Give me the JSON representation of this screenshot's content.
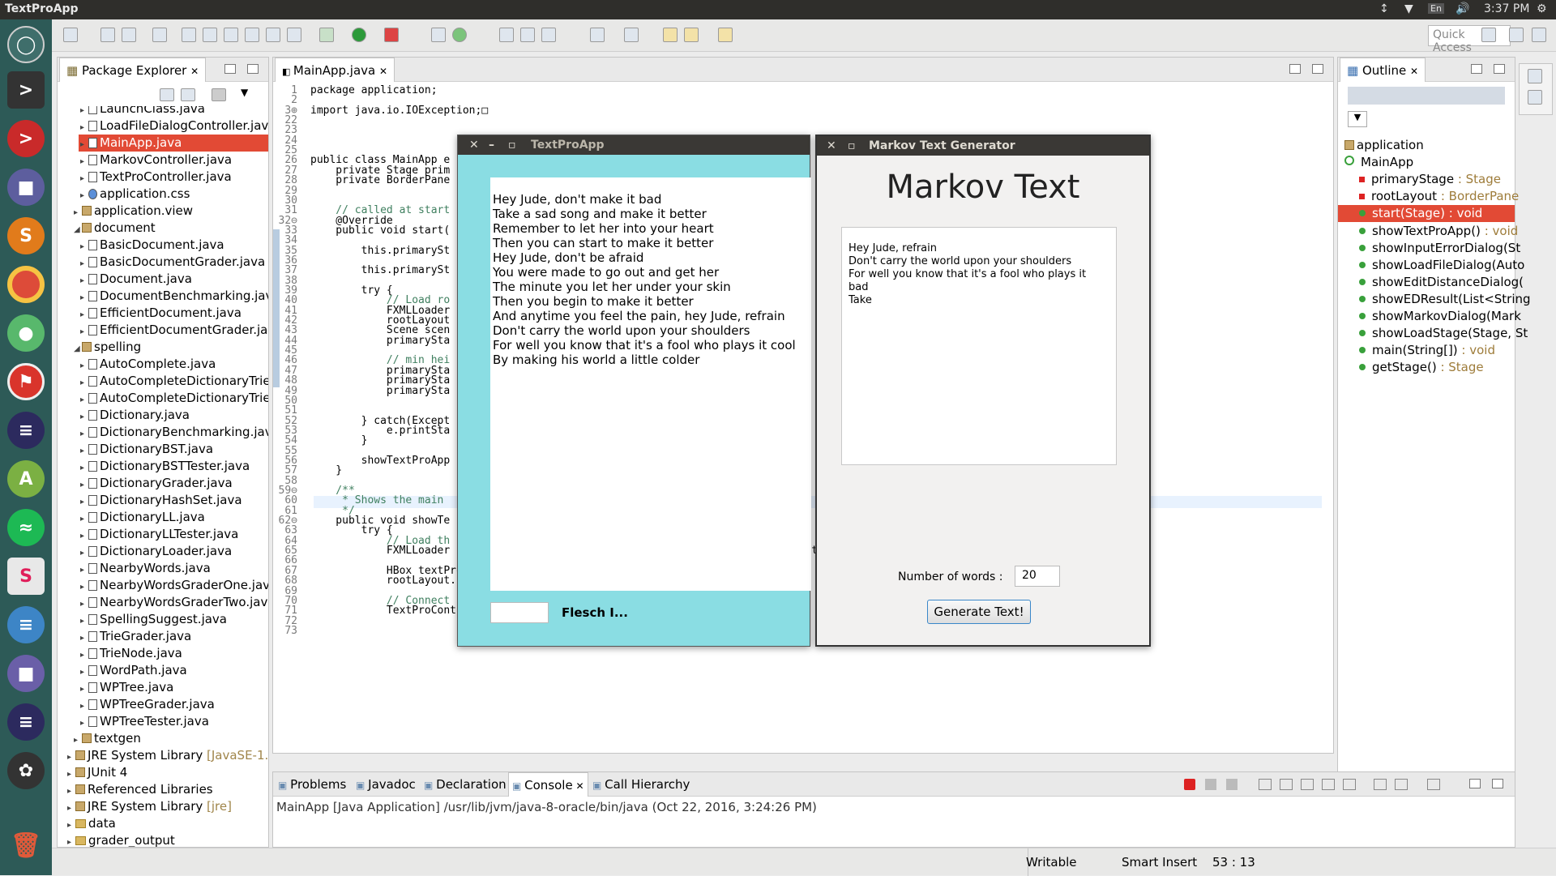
{
  "topbar": {
    "app_title": "TextProApp",
    "lang": "En",
    "time": "3:37 PM"
  },
  "launcher": {
    "icons": [
      "ubuntu-icon",
      "terminal-icon",
      "terminal-red-icon",
      "files-icon",
      "sublime-icon",
      "chrome-icon",
      "toggle-icon",
      "bookmark-icon",
      "eclipse-icon",
      "android-icon",
      "spotify-icon",
      "slack-icon",
      "document-icon",
      "folder-icon",
      "eclipse2-icon",
      "settings-icon",
      "trash-icon"
    ]
  },
  "toolbar": {
    "quick_access": "Quick Access"
  },
  "package_explorer": {
    "title": "Package Explorer",
    "items": [
      {
        "label": "LaunchClass.java",
        "indent": 3,
        "kind": "file"
      },
      {
        "label": "LoadFileDialogController.java",
        "indent": 3,
        "kind": "file"
      },
      {
        "label": "MainApp.java",
        "indent": 3,
        "kind": "file",
        "selected": true
      },
      {
        "label": "MarkovController.java",
        "indent": 3,
        "kind": "file"
      },
      {
        "label": "TextProController.java",
        "indent": 3,
        "kind": "file"
      },
      {
        "label": "application.css",
        "indent": 3,
        "kind": "css"
      },
      {
        "label": "application.view",
        "indent": 2,
        "kind": "pkg"
      },
      {
        "label": "document",
        "indent": 2,
        "kind": "pkg",
        "open": true
      },
      {
        "label": "BasicDocument.java",
        "indent": 3,
        "kind": "file"
      },
      {
        "label": "BasicDocumentGrader.java",
        "indent": 3,
        "kind": "file"
      },
      {
        "label": "Document.java",
        "indent": 3,
        "kind": "file"
      },
      {
        "label": "DocumentBenchmarking.java",
        "indent": 3,
        "kind": "file"
      },
      {
        "label": "EfficientDocument.java",
        "indent": 3,
        "kind": "file"
      },
      {
        "label": "EfficientDocumentGrader.java",
        "indent": 3,
        "kind": "file"
      },
      {
        "label": "spelling",
        "indent": 2,
        "kind": "pkg",
        "open": true
      },
      {
        "label": "AutoComplete.java",
        "indent": 3,
        "kind": "file"
      },
      {
        "label": "AutoCompleteDictionaryTrie.java",
        "indent": 3,
        "kind": "file"
      },
      {
        "label": "AutoCompleteDictionaryTrieTester.java",
        "indent": 3,
        "kind": "file"
      },
      {
        "label": "Dictionary.java",
        "indent": 3,
        "kind": "file"
      },
      {
        "label": "DictionaryBenchmarking.java",
        "indent": 3,
        "kind": "file"
      },
      {
        "label": "DictionaryBST.java",
        "indent": 3,
        "kind": "file"
      },
      {
        "label": "DictionaryBSTTester.java",
        "indent": 3,
        "kind": "file"
      },
      {
        "label": "DictionaryGrader.java",
        "indent": 3,
        "kind": "file"
      },
      {
        "label": "DictionaryHashSet.java",
        "indent": 3,
        "kind": "file"
      },
      {
        "label": "DictionaryLL.java",
        "indent": 3,
        "kind": "file"
      },
      {
        "label": "DictionaryLLTester.java",
        "indent": 3,
        "kind": "file"
      },
      {
        "label": "DictionaryLoader.java",
        "indent": 3,
        "kind": "file"
      },
      {
        "label": "NearbyWords.java",
        "indent": 3,
        "kind": "file"
      },
      {
        "label": "NearbyWordsGraderOne.java",
        "indent": 3,
        "kind": "file"
      },
      {
        "label": "NearbyWordsGraderTwo.java",
        "indent": 3,
        "kind": "file"
      },
      {
        "label": "SpellingSuggest.java",
        "indent": 3,
        "kind": "file"
      },
      {
        "label": "TrieGrader.java",
        "indent": 3,
        "kind": "file"
      },
      {
        "label": "TrieNode.java",
        "indent": 3,
        "kind": "file"
      },
      {
        "label": "WordPath.java",
        "indent": 3,
        "kind": "file"
      },
      {
        "label": "WPTree.java",
        "indent": 3,
        "kind": "file"
      },
      {
        "label": "WPTreeGrader.java",
        "indent": 3,
        "kind": "file"
      },
      {
        "label": "WPTreeTester.java",
        "indent": 3,
        "kind": "file"
      },
      {
        "label": "textgen",
        "indent": 2,
        "kind": "pkg"
      },
      {
        "label": "JRE System Library",
        "suffix": "[JavaSE-1.8]",
        "indent": 1,
        "kind": "lib"
      },
      {
        "label": "JUnit 4",
        "indent": 1,
        "kind": "lib"
      },
      {
        "label": "Referenced Libraries",
        "indent": 1,
        "kind": "lib"
      },
      {
        "label": "JRE System Library",
        "suffix": "[jre]",
        "indent": 1,
        "kind": "lib"
      },
      {
        "label": "data",
        "indent": 1,
        "kind": "folder"
      },
      {
        "label": "grader_output",
        "indent": 1,
        "kind": "folder"
      }
    ]
  },
  "editor": {
    "tab": "MainApp.java",
    "lines": [
      {
        "n": "1",
        "t": "package application;"
      },
      {
        "n": "2",
        "t": ""
      },
      {
        "n": "3⊕",
        "t": "import java.io.IOException;□"
      },
      {
        "n": "22",
        "t": ""
      },
      {
        "n": "23",
        "t": ""
      },
      {
        "n": "24",
        "t": ""
      },
      {
        "n": "25",
        "t": ""
      },
      {
        "n": "26",
        "t": "public class MainApp e"
      },
      {
        "n": "27",
        "t": "    private Stage prim"
      },
      {
        "n": "28",
        "t": "    private BorderPane"
      },
      {
        "n": "29",
        "t": ""
      },
      {
        "n": "30",
        "t": ""
      },
      {
        "n": "31",
        "t": "    // called at start"
      },
      {
        "n": "32⊖",
        "t": "    @Override"
      },
      {
        "n": "33",
        "t": "    public void start("
      },
      {
        "n": "34",
        "t": ""
      },
      {
        "n": "35",
        "t": "        this.primarySt"
      },
      {
        "n": "36",
        "t": ""
      },
      {
        "n": "37",
        "t": "        this.primarySt"
      },
      {
        "n": "38",
        "t": ""
      },
      {
        "n": "39",
        "t": "        try {"
      },
      {
        "n": "40",
        "t": "            // Load ro"
      },
      {
        "n": "41",
        "t": "            FXMLLoader"
      },
      {
        "n": "42",
        "t": "            rootLayout"
      },
      {
        "n": "43",
        "t": "            Scene scen"
      },
      {
        "n": "44",
        "t": "            primarySta"
      },
      {
        "n": "45",
        "t": ""
      },
      {
        "n": "46",
        "t": "            // min hei"
      },
      {
        "n": "47",
        "t": "            primarySta"
      },
      {
        "n": "48",
        "t": "            primarySta"
      },
      {
        "n": "49",
        "t": "            primarySta"
      },
      {
        "n": "50",
        "t": ""
      },
      {
        "n": "51",
        "t": ""
      },
      {
        "n": "52",
        "t": "        } catch(Except"
      },
      {
        "n": "53",
        "t": "            e.printSta"
      },
      {
        "n": "54",
        "t": "        }"
      },
      {
        "n": "55",
        "t": ""
      },
      {
        "n": "56",
        "t": "        showTextProApp"
      },
      {
        "n": "57",
        "t": "    }"
      },
      {
        "n": "58",
        "t": ""
      },
      {
        "n": "59⊖",
        "t": "    /**"
      },
      {
        "n": "60",
        "t": "     * Shows the main"
      },
      {
        "n": "61",
        "t": "     */"
      },
      {
        "n": "62⊖",
        "t": "    public void showTe"
      },
      {
        "n": "63",
        "t": "        try {"
      },
      {
        "n": "64",
        "t": "            // Load th"
      },
      {
        "n": "65",
        "t": "            FXMLLoader loader = new FXMLLoader(getClass().getResource(\"view/TextAppLayout.fxml\"));"
      },
      {
        "n": "66",
        "t": ""
      },
      {
        "n": "67",
        "t": "            HBox textProPage = (HBox) loader.load();"
      },
      {
        "n": "68",
        "t": "            rootLayout.setCenter(textProPage);"
      },
      {
        "n": "69",
        "t": ""
      },
      {
        "n": "70",
        "t": "            // Connect controller and main app"
      },
      {
        "n": "71",
        "t": "            TextProController controller = loader.getController();"
      },
      {
        "n": "72",
        "t": ""
      },
      {
        "n": "73",
        "t": ""
      }
    ]
  },
  "textpro_dialog": {
    "title": "TextProApp",
    "lines": [
      "Hey Jude, don't make it bad",
      "Take a sad song and make it better",
      "Remember to let her into your heart",
      "Then you can start to make it better",
      "Hey Jude, don't be afraid",
      "You were made to go out and get her",
      "The minute you let her under your skin",
      "Then you begin to make it better",
      "And anytime you feel the pain, hey Jude, refrain",
      "Don't carry the world upon your shoulders",
      "For well you know that it's a fool who plays it cool",
      "By making his world a little colder"
    ],
    "flesch_label": "Flesch I..."
  },
  "markov_dialog": {
    "title": "Markov Text Generator",
    "heading": "Markov Text",
    "output_lines": [
      "Hey Jude, refrain",
      "Don't carry the world upon your shoulders",
      "For well you know that it's a fool who plays it",
      "bad",
      "Take"
    ],
    "words_label": "Number of words :",
    "words_value": "20",
    "generate_label": "Generate Text!"
  },
  "outline": {
    "title": "Outline",
    "items": [
      {
        "name": "application",
        "type": "",
        "kind": "import",
        "indent": 0
      },
      {
        "name": "MainApp",
        "type": "",
        "kind": "class",
        "indent": 0
      },
      {
        "name": "primaryStage",
        "type": " : Stage",
        "kind": "field",
        "indent": 1
      },
      {
        "name": "rootLayout",
        "type": " : BorderPane",
        "kind": "field",
        "indent": 1
      },
      {
        "name": "start(Stage)",
        "type": " : void",
        "kind": "method",
        "indent": 1,
        "selected": true
      },
      {
        "name": "showTextProApp()",
        "type": " : void",
        "kind": "method",
        "indent": 1
      },
      {
        "name": "showInputErrorDialog(St",
        "type": "",
        "kind": "method",
        "indent": 1
      },
      {
        "name": "showLoadFileDialog(Auto",
        "type": "",
        "kind": "method",
        "indent": 1
      },
      {
        "name": "showEditDistanceDialog(",
        "type": "",
        "kind": "method",
        "indent": 1
      },
      {
        "name": "showEDResult(List<String",
        "type": "",
        "kind": "method",
        "indent": 1
      },
      {
        "name": "showMarkovDialog(Mark",
        "type": "",
        "kind": "method",
        "indent": 1
      },
      {
        "name": "showLoadStage(Stage, St",
        "type": "",
        "kind": "method",
        "indent": 1
      },
      {
        "name": "main(String[])",
        "type": " : void",
        "kind": "method",
        "indent": 1
      },
      {
        "name": "getStage()",
        "type": " : Stage",
        "kind": "method",
        "indent": 1
      }
    ]
  },
  "console": {
    "tabs": [
      {
        "label": "Problems",
        "icon": "problems-icon"
      },
      {
        "label": "Javadoc",
        "icon": "javadoc-icon"
      },
      {
        "label": "Declaration",
        "icon": "declaration-icon"
      },
      {
        "label": "Console",
        "icon": "console-icon",
        "active": true
      },
      {
        "label": "Call Hierarchy",
        "icon": "call-hierarchy-icon"
      }
    ],
    "line": "MainApp [Java Application] /usr/lib/jvm/java-8-oracle/bin/java (Oct 22, 2016, 3:24:26 PM)"
  },
  "statusbar": {
    "writable": "Writable",
    "insert": "Smart Insert",
    "position": "53 : 13"
  },
  "colors": {
    "selection": "#e24a35",
    "dialog_cyan": "#8adde3",
    "launcher": "#2d5a57"
  }
}
